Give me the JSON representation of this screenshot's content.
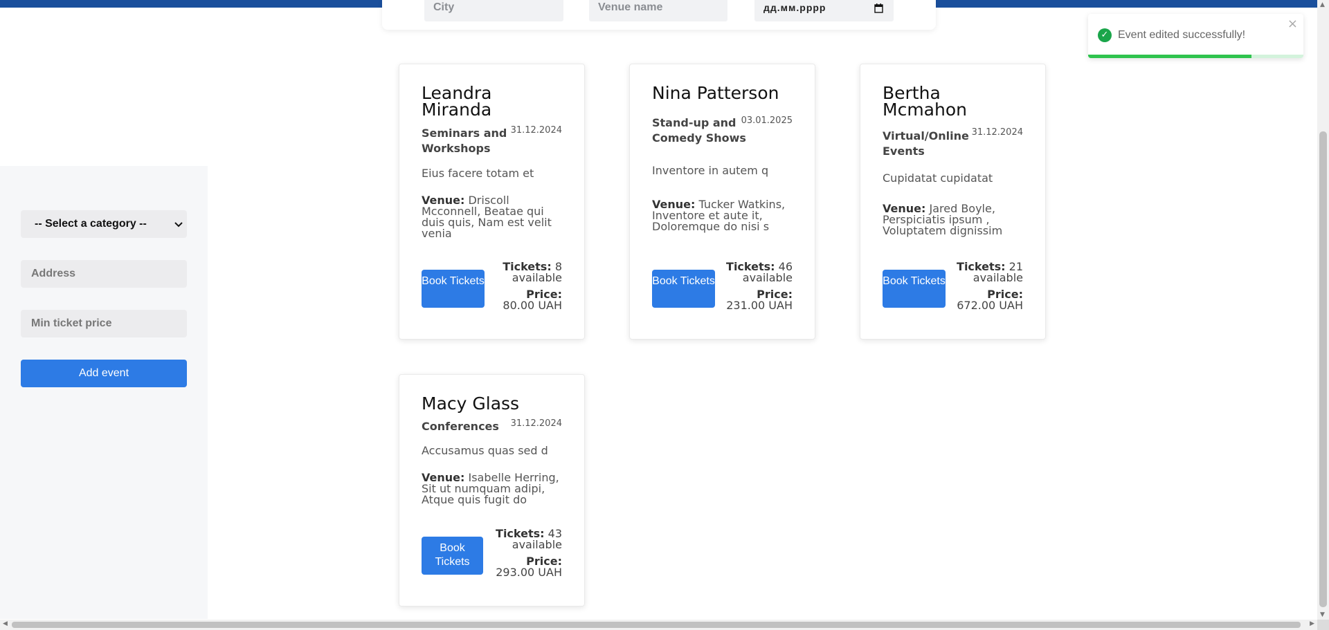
{
  "filters": {
    "city_placeholder": "City",
    "venue_placeholder": "Venue name",
    "date_placeholder": "дд.мм.рррр"
  },
  "sidebar": {
    "category_select": "-- Select a category --",
    "address_placeholder": "Address",
    "min_price_placeholder": "Min ticket price",
    "add_event_label": "Add event"
  },
  "events": [
    {
      "title": "Leandra Miranda",
      "category": "Seminars and Workshops",
      "date": "31.12.2024",
      "description": "Eius facere totam et",
      "venue_label": "Venue:",
      "venue": "Driscoll Mcconnell, Beatae qui duis quis, Nam est velit venia",
      "book_label": "Book Tickets",
      "tickets_label": "Tickets:",
      "tickets": "8 available",
      "price_label": "Price:",
      "price": "80.00 UAH"
    },
    {
      "title": "Nina Patterson",
      "category": "Stand-up and Comedy Shows",
      "date": "03.01.2025",
      "description": "Inventore in autem q",
      "venue_label": "Venue:",
      "venue": "Tucker Watkins, Inventore et aute it, Doloremque do nisi s",
      "book_label": "Book Tickets",
      "tickets_label": "Tickets:",
      "tickets": "46 available",
      "price_label": "Price:",
      "price": "231.00 UAH"
    },
    {
      "title": "Bertha Mcmahon",
      "category": "Virtual/Online Events",
      "date": "31.12.2024",
      "description": "Cupidatat cupidatat",
      "venue_label": "Venue:",
      "venue": "Jared Boyle, Perspiciatis ipsum , Voluptatem dignissim",
      "book_label": "Book Tickets",
      "tickets_label": "Tickets:",
      "tickets": "21 available",
      "price_label": "Price:",
      "price": "672.00 UAH"
    },
    {
      "title": "Macy Glass",
      "category": "Conferences",
      "date": "31.12.2024",
      "description": "Accusamus quas sed d",
      "venue_label": "Venue:",
      "venue": "Isabelle Herring, Sit ut numquam adipi, Atque quis fugit do",
      "book_label": "Book Tickets",
      "tickets_label": "Tickets:",
      "tickets": "43 available",
      "price_label": "Price:",
      "price": "293.00 UAH"
    }
  ],
  "toast": {
    "message": "Event edited successfully!",
    "close_symbol": "×",
    "progress_fraction": 0.76,
    "success_color": "#1aa54a"
  },
  "colors": {
    "primary": "#2d7be5",
    "topbar": "#1a4f9c"
  }
}
